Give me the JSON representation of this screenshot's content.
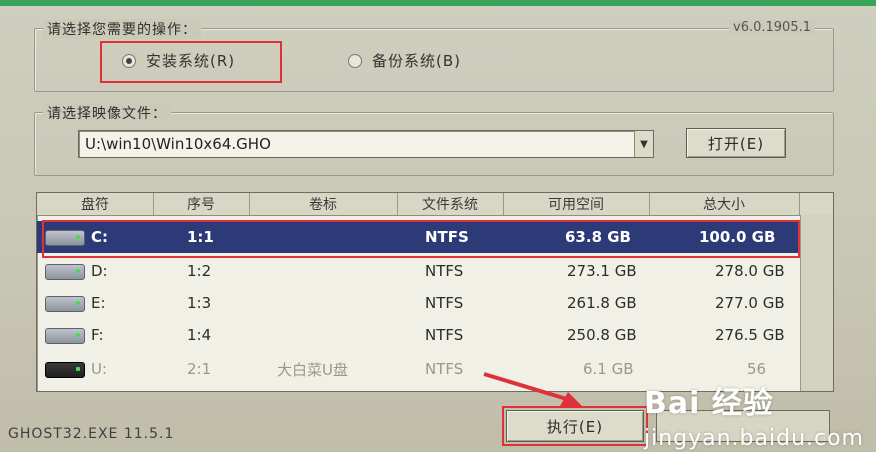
{
  "operation_group": {
    "legend": "请选择您需要的操作：",
    "version": "v6.0.1905.1",
    "options": [
      {
        "label": "安装系统(R)",
        "checked": true
      },
      {
        "label": "备份系统(B)",
        "checked": false
      }
    ]
  },
  "image_group": {
    "legend": "请选择映像文件：",
    "path_value": "U:\\win10\\Win10x64.GHO",
    "open_button": "打开(E)"
  },
  "partition_table": {
    "headers": [
      "盘符",
      "序号",
      "卷标",
      "文件系统",
      "可用空间",
      "总大小"
    ],
    "rows": [
      {
        "drive": "C:",
        "index": "1:1",
        "label": "",
        "fs": "NTFS",
        "free": "63.8 GB",
        "total": "100.0 GB",
        "selected": true
      },
      {
        "drive": "D:",
        "index": "1:2",
        "label": "",
        "fs": "NTFS",
        "free": "273.1 GB",
        "total": "278.0 GB",
        "selected": false
      },
      {
        "drive": "E:",
        "index": "1:3",
        "label": "",
        "fs": "NTFS",
        "free": "261.8 GB",
        "total": "277.0 GB",
        "selected": false
      },
      {
        "drive": "F:",
        "index": "1:4",
        "label": "",
        "fs": "NTFS",
        "free": "250.8 GB",
        "total": "276.5 GB",
        "selected": false
      },
      {
        "drive": "U:",
        "index": "2:1",
        "label": "大白菜U盘",
        "fs": "NTFS",
        "free": "6.1 GB",
        "total": "56",
        "selected": false
      }
    ]
  },
  "footer": {
    "status": "GHOST32.EXE 11.5.1",
    "execute_button": "执行(E)"
  },
  "watermark": {
    "brand": "Bai  经验",
    "url": "jingyan.baidu.com"
  },
  "colors": {
    "selected_row": "#2d3a78",
    "highlight": "#e0303a",
    "accent_bar": "#3aa35a"
  }
}
